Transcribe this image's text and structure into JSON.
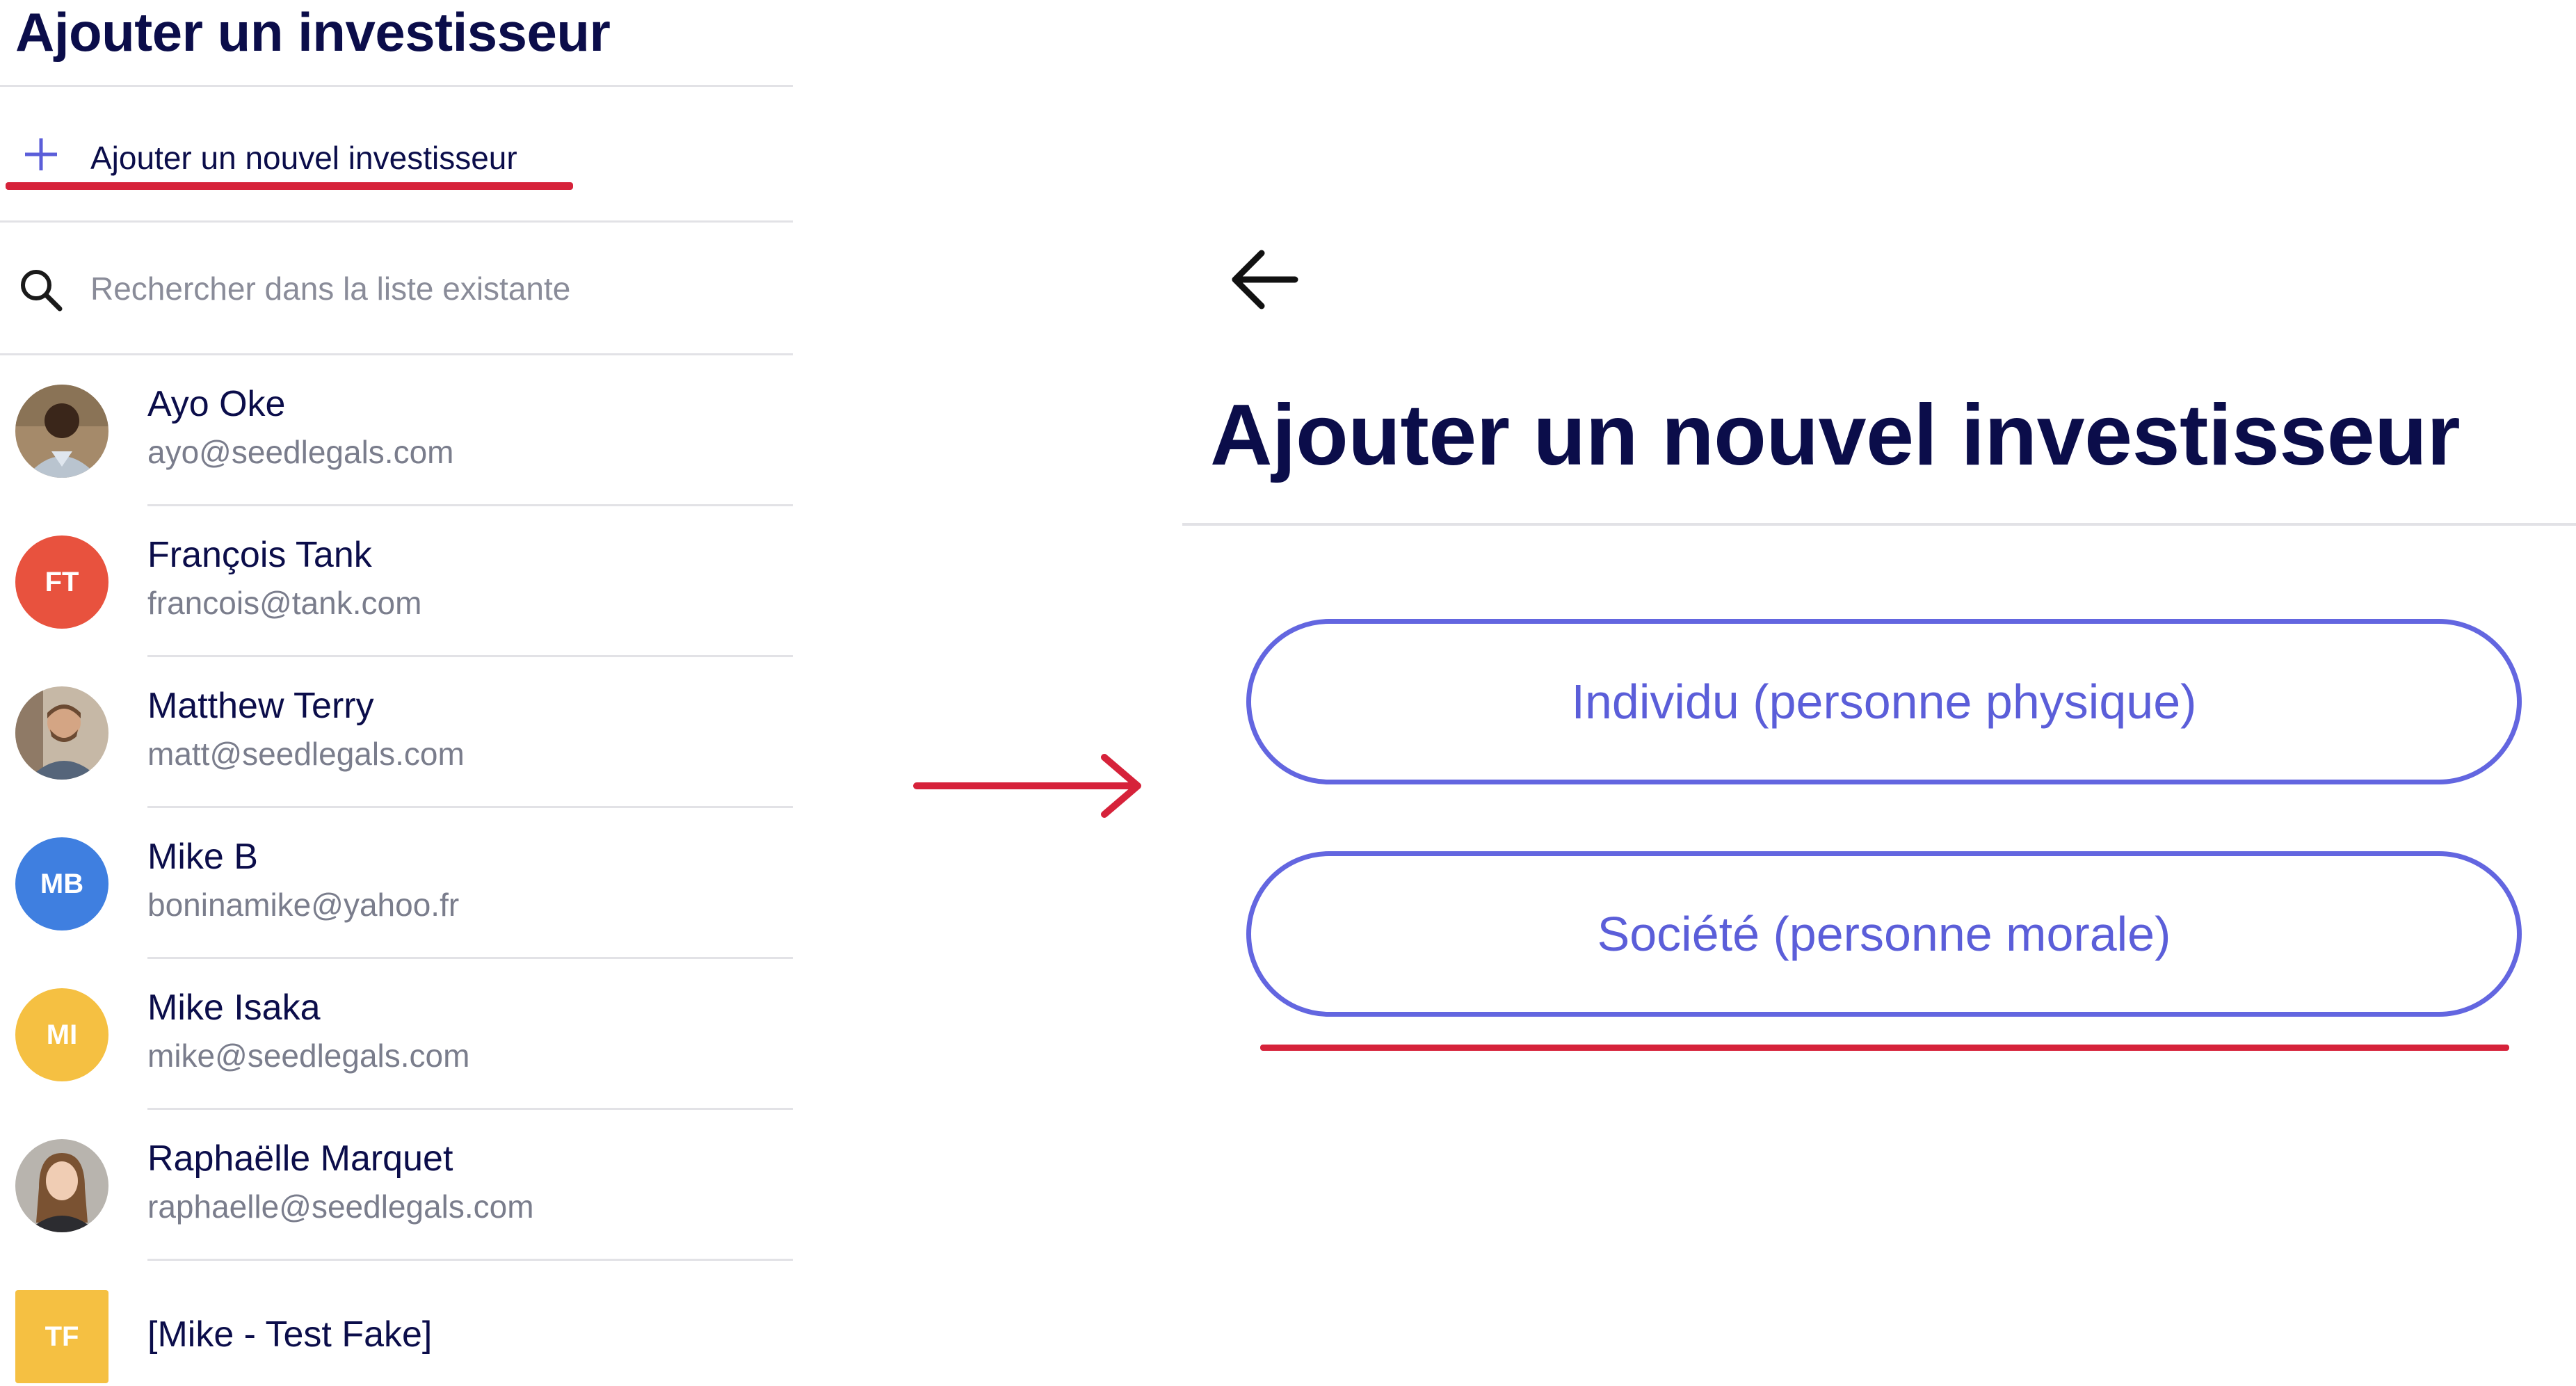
{
  "left_panel": {
    "title": "Ajouter un investisseur",
    "add_label": "Ajouter un nouvel investisseur",
    "search": {
      "placeholder": "Rechercher dans la liste existante"
    },
    "investors": [
      {
        "name": "Ayo Oke",
        "email": "ayo@seedlegals.com",
        "avatar": "photo"
      },
      {
        "name": "François Tank",
        "email": "francois@tank.com",
        "initials": "FT",
        "color": "#e8523e"
      },
      {
        "name": "Matthew Terry",
        "email": "matt@seedlegals.com",
        "avatar": "photo"
      },
      {
        "name": "Mike B",
        "email": "boninamike@yahoo.fr",
        "initials": "MB",
        "color": "#3f7fe0"
      },
      {
        "name": "Mike Isaka",
        "email": "mike@seedlegals.com",
        "initials": "MI",
        "color": "#f5c042"
      },
      {
        "name": "Raphaëlle Marquet",
        "email": "raphaelle@seedlegals.com",
        "avatar": "photo"
      },
      {
        "name": "[Mike - Test Fake]",
        "initials": "TF",
        "color": "#f5c042"
      }
    ]
  },
  "right_panel": {
    "title": "Ajouter un nouvel investisseur",
    "options": {
      "individual": "Individu (personne physique)",
      "company": "Société (personne morale)"
    }
  },
  "colors": {
    "title": "#0b0d4a",
    "accent": "#6366e0",
    "annotation": "#d6223a",
    "muted": "#7a7d8c"
  },
  "icons": [
    "plus-icon",
    "search-icon",
    "back-arrow-icon",
    "annotation-arrow-icon"
  ]
}
